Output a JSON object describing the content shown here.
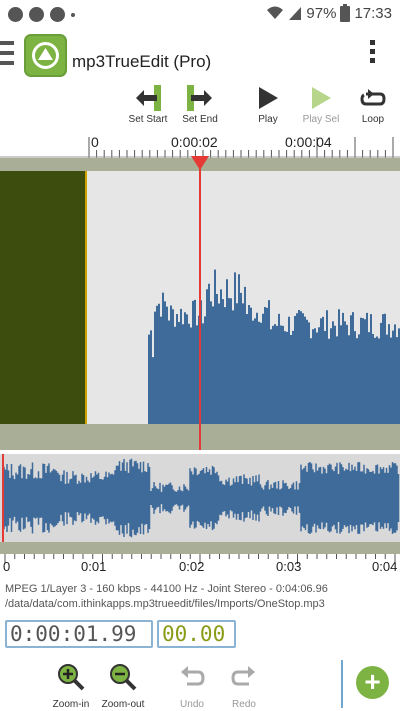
{
  "status_bar": {
    "battery": "97%",
    "time": "17:33"
  },
  "app": {
    "title": "mp3TrueEdit (Pro)"
  },
  "toolbar": [
    {
      "id": "set-start",
      "label": "Set Start",
      "icon": "set-start-icon",
      "enabled": true
    },
    {
      "id": "set-end",
      "label": "Set End",
      "icon": "set-end-icon",
      "enabled": true
    },
    {
      "id": "play",
      "label": "Play",
      "icon": "play-icon",
      "enabled": true
    },
    {
      "id": "play-sel",
      "label": "Play Sel",
      "icon": "play-selection-icon",
      "enabled": false
    },
    {
      "id": "loop",
      "label": "Loop",
      "icon": "loop-icon",
      "enabled": true
    }
  ],
  "timeline": {
    "labels": [
      "0",
      "0:00:02",
      "0:00:04"
    ]
  },
  "overview": {
    "labels": [
      "0",
      "0:01",
      "0:02",
      "0:03",
      "0:04"
    ]
  },
  "file_info": {
    "format": "MPEG 1/Layer 3 - 160 kbps - 44100 Hz - Joint Stereo - 0:04:06.96",
    "path": "/data/data/com.ithinkapps.mp3trueedit/files/Imports/OneStop.mp3"
  },
  "position": {
    "time": "0:00:01.99",
    "selection": "00.00"
  },
  "bottom_bar": [
    {
      "id": "zoom-in",
      "label": "Zoom-in",
      "icon": "zoom-in-icon",
      "enabled": true
    },
    {
      "id": "zoom-out",
      "label": "Zoom-out",
      "icon": "zoom-out-icon",
      "enabled": true
    },
    {
      "id": "undo",
      "label": "Undo",
      "icon": "undo-icon",
      "enabled": false
    },
    {
      "id": "redo",
      "label": "Redo",
      "icon": "redo-icon",
      "enabled": false
    }
  ],
  "colors": {
    "accent_green": "#7cb342",
    "waveform": "#3f6b9a",
    "selection": "#3c4d0e",
    "playhead": "#e53935",
    "band": "#a9ae97"
  }
}
